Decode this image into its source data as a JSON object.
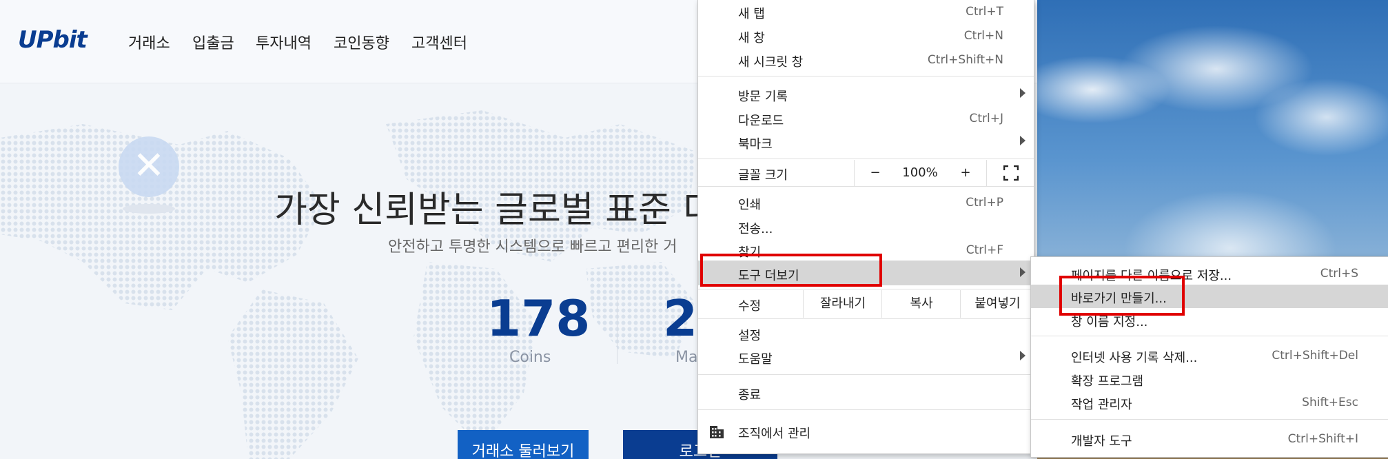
{
  "site": {
    "logo": "UPbit",
    "nav": [
      "거래소",
      "입출금",
      "투자내역",
      "코인동향",
      "고객센터"
    ],
    "hero_title": "가장 신뢰받는 글로벌 표준 디",
    "hero_subtitle": "안전하고 투명한 시스템으로 빠르고 편리한 거",
    "stats": [
      {
        "value": "178",
        "label": "Coins"
      },
      {
        "value": "2(",
        "label": "Ma"
      }
    ],
    "cta_primary": "거래소 둘러보기",
    "cta_secondary": "로그인",
    "coin_icon": "xrp-icon",
    "colors": {
      "brand": "#0a3d91",
      "cta": "#1261c4"
    }
  },
  "menu": {
    "new_tab": {
      "label": "새 탭",
      "shortcut": "Ctrl+T"
    },
    "new_window": {
      "label": "새 창",
      "shortcut": "Ctrl+N"
    },
    "new_incognito": {
      "label": "새 시크릿 창",
      "shortcut": "Ctrl+Shift+N"
    },
    "history": {
      "label": "방문 기록"
    },
    "downloads": {
      "label": "다운로드",
      "shortcut": "Ctrl+J"
    },
    "bookmarks": {
      "label": "북마크"
    },
    "zoom": {
      "label": "글꼴 크기",
      "minus": "−",
      "value": "100%",
      "plus": "+",
      "fullscreen_icon": "fullscreen-icon"
    },
    "print": {
      "label": "인쇄",
      "shortcut": "Ctrl+P"
    },
    "cast": {
      "label": "전송..."
    },
    "find": {
      "label": "찾기",
      "shortcut": "Ctrl+F"
    },
    "more_tools": {
      "label": "도구 더보기"
    },
    "edit": {
      "label": "수정",
      "cut": "잘라내기",
      "copy": "복사",
      "paste": "붙여넣기"
    },
    "settings": {
      "label": "설정"
    },
    "help": {
      "label": "도움말"
    },
    "exit": {
      "label": "종료"
    },
    "managed": {
      "label": "조직에서 관리",
      "icon": "building-icon"
    }
  },
  "submenu": {
    "save_page": {
      "label": "페이지를 다른 이름으로 저장...",
      "shortcut": "Ctrl+S"
    },
    "create_shortcut": {
      "label": "바로가기 만들기..."
    },
    "name_window": {
      "label": "창 이름 지정..."
    },
    "clear_data": {
      "label": "인터넷 사용 기록 삭제...",
      "shortcut": "Ctrl+Shift+Del"
    },
    "extensions": {
      "label": "확장 프로그램"
    },
    "task_manager": {
      "label": "작업 관리자",
      "shortcut": "Shift+Esc"
    },
    "dev_tools": {
      "label": "개발자 도구",
      "shortcut": "Ctrl+Shift+I"
    }
  },
  "annotations": {
    "highlight_color": "#e00000"
  }
}
